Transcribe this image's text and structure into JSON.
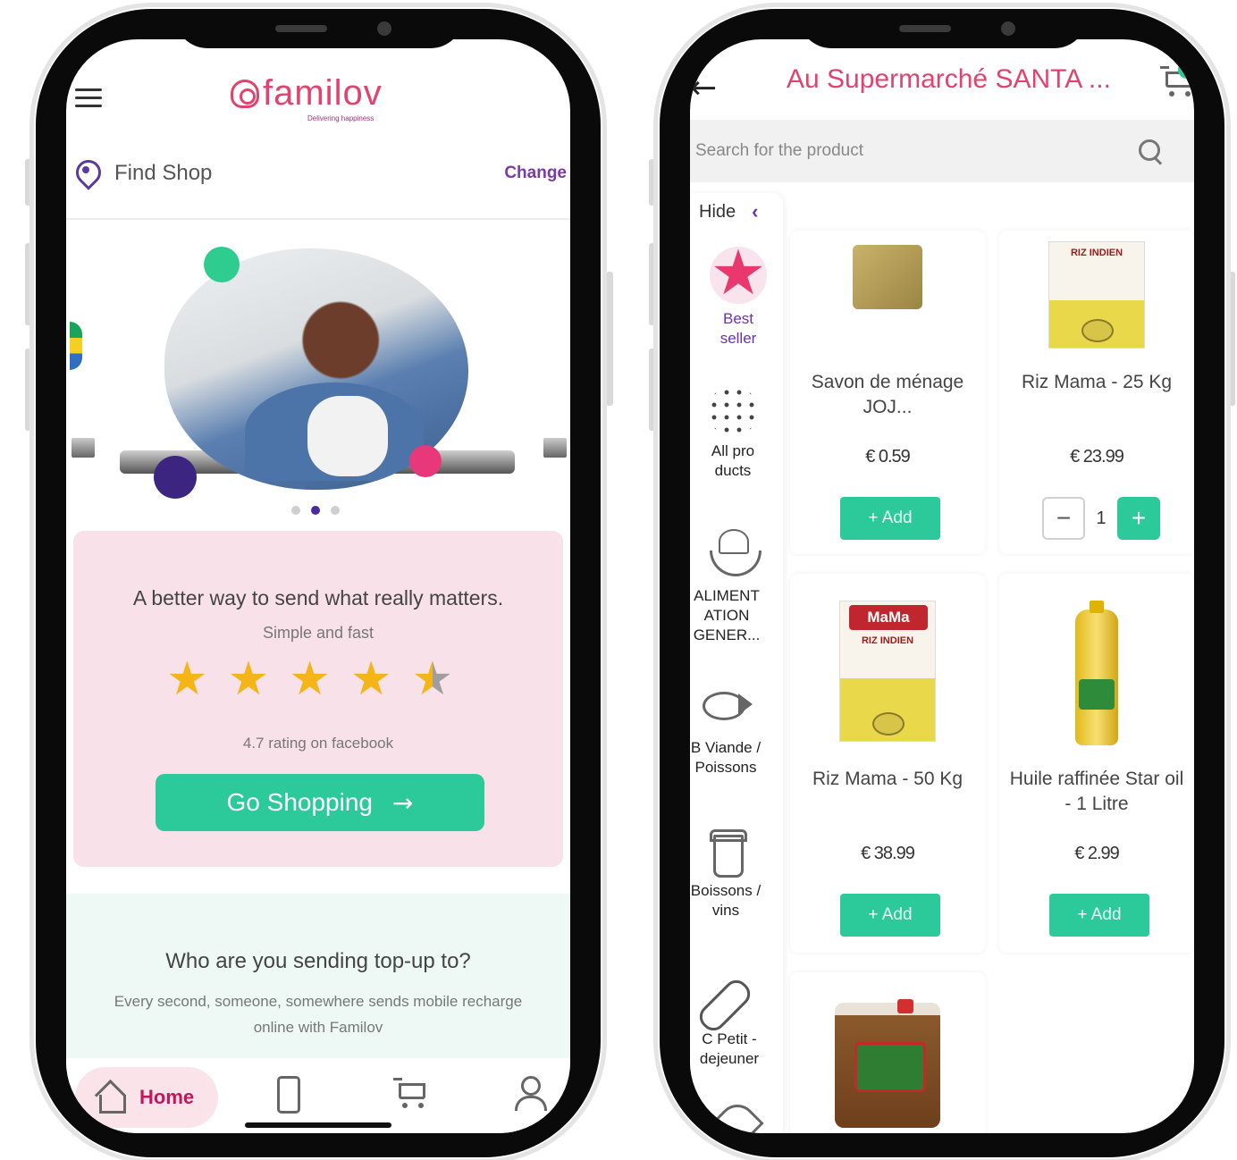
{
  "left_phone": {
    "logo": {
      "name": "familov",
      "tagline": "Delivering happiness"
    },
    "location": {
      "label": "Find Shop",
      "change_label": "Change"
    },
    "carousel": {
      "dots": 3,
      "active_index": 1
    },
    "promo": {
      "title": "A better way to send what really matters.",
      "subtitle": "Simple and fast",
      "rating_value": 4.7,
      "stars_full": 4,
      "stars_half": 1,
      "rating_text": "4.7 rating on facebook",
      "cta_label": "Go Shopping",
      "cta_arrow": "→"
    },
    "topup": {
      "title": "Who are you sending top-up to?",
      "text": "Every second, someone, somewhere sends mobile recharge online with Familov"
    },
    "bottom_nav": {
      "home_label": "Home"
    }
  },
  "right_phone": {
    "header": {
      "back_arrow": "←",
      "title": "Au Supermarché SANTA ..."
    },
    "search": {
      "placeholder": "Search for the product"
    },
    "categories": {
      "hide_label": "Hide",
      "hide_chevron": "‹",
      "items": [
        {
          "label": "Best seller",
          "icon": "star-icon"
        },
        {
          "label": "All pro ducts",
          "icon": "dots-icon"
        },
        {
          "label": "ALIMENT ATION GENER...",
          "icon": "bowl-icon"
        },
        {
          "label": "B Viande / Poissons",
          "icon": "fish-icon"
        },
        {
          "label": "Boissons / vins",
          "icon": "cup-icon"
        },
        {
          "label": "C Petit -dejeuner",
          "icon": "bread-icon"
        }
      ]
    },
    "products": [
      {
        "name": "Savon de ménage JOJ...",
        "price": "€ 0.59",
        "action": "+ Add"
      },
      {
        "name": "Riz Mama - 25 Kg",
        "price": "€ 23.99",
        "quantity": "1",
        "minus": "−",
        "plus": "+"
      },
      {
        "name": "Riz Mama - 50 Kg",
        "price": "€ 38.99",
        "action": "+ Add"
      },
      {
        "name": "Huile raffinée Star oil - 1 Litre",
        "price": "€ 2.99",
        "action": "+ Add"
      }
    ],
    "product_image_labels": {
      "rice_brand": "RIZ INDIEN",
      "rice_logo": "MaMa"
    }
  },
  "colors": {
    "brand_pink": "#e2436e",
    "accent_green": "#2cc99a",
    "purple": "#6a32b0",
    "promo_bg": "#f8e1e8",
    "topup_bg": "#eef9f6",
    "star_gold": "#f5b518"
  }
}
